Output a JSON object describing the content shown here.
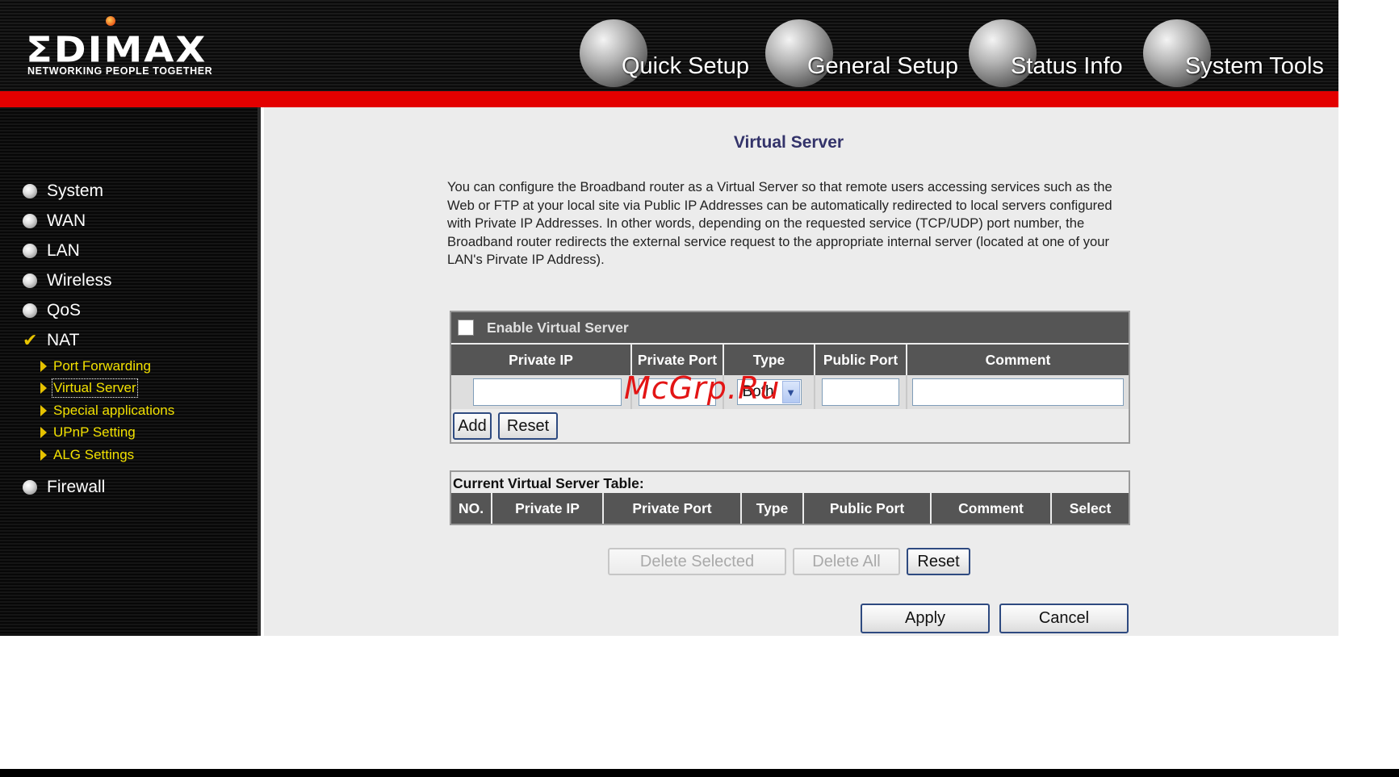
{
  "brand": {
    "logo_text": "ΣDIMAX",
    "tagline": "NETWORKING PEOPLE TOGETHER"
  },
  "top_nav": [
    {
      "label": "Quick Setup",
      "icon": "hand-orb-icon"
    },
    {
      "label": "General Setup",
      "icon": "keyboard-orb-icon"
    },
    {
      "label": "Status Info",
      "icon": "router-orb-icon"
    },
    {
      "label": "System Tools",
      "icon": "tools-orb-icon"
    }
  ],
  "sidebar": {
    "items": [
      {
        "label": "System"
      },
      {
        "label": "WAN"
      },
      {
        "label": "LAN"
      },
      {
        "label": "Wireless"
      },
      {
        "label": "QoS"
      },
      {
        "label": "NAT"
      },
      {
        "label": "Firewall"
      }
    ],
    "nat_sub": [
      {
        "label": "Port Forwarding"
      },
      {
        "label": "Virtual Server",
        "active": true
      },
      {
        "label": "Special applications"
      },
      {
        "label": "UPnP Setting"
      },
      {
        "label": "ALG Settings"
      }
    ]
  },
  "page": {
    "title": "Virtual Server",
    "intro": " You can configure the Broadband router as a Virtual Server so that remote users accessing services such as the Web or FTP at your local site via Public IP Addresses can be automatically redirected to local servers configured with Private IP Addresses. In other words, depending on the requested service (TCP/UDP) port number, the Broadband router redirects the external service request to the appropriate internal server (located at one of your LAN's Pirvate IP Address).",
    "enable_label": "Enable Virtual Server",
    "form_headers": [
      "Private IP",
      "Private Port",
      "Type",
      "Public Port",
      "Comment"
    ],
    "type_value": "Both",
    "add_button": "Add",
    "reset_button": "Reset",
    "table_title": "Current Virtual Server Table:",
    "table_headers": [
      "NO.",
      "Private IP",
      "Private Port",
      "Type",
      "Public Port",
      "Comment",
      "Select"
    ],
    "delete_selected": "Delete Selected",
    "delete_all": "Delete All",
    "table_reset": "Reset",
    "apply": "Apply",
    "cancel": "Cancel"
  },
  "watermark": "McGrp.Ru"
}
